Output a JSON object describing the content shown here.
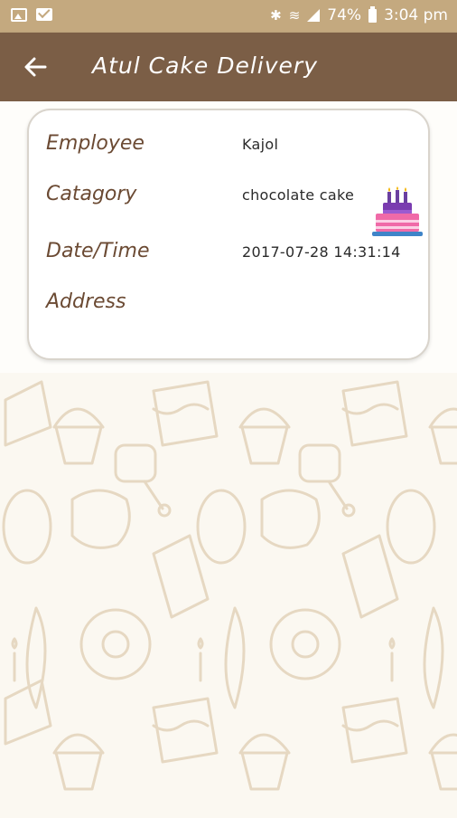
{
  "status_bar": {
    "battery_percent": "74%",
    "time": "3:04 pm",
    "icons": [
      "image-icon",
      "mail-icon",
      "bluetooth-icon",
      "wifi-icon",
      "signal-icon",
      "battery-icon"
    ]
  },
  "app_bar": {
    "back_icon": "arrow-back-icon",
    "title": "Atul Cake Delivery"
  },
  "details": {
    "employee_label": "Employee",
    "employee_value": "Kajol",
    "category_label": "Catagory",
    "category_value": "chocolate cake",
    "datetime_label": "Date/Time",
    "datetime_value": "2017-07-28 14:31:14",
    "address_label": "Address",
    "address_value": ""
  },
  "colors": {
    "status_bar": "#c4a97f",
    "app_bar": "#7b5e46",
    "label_text": "#6b4a33",
    "pattern_stroke": "#e6d8c2"
  }
}
